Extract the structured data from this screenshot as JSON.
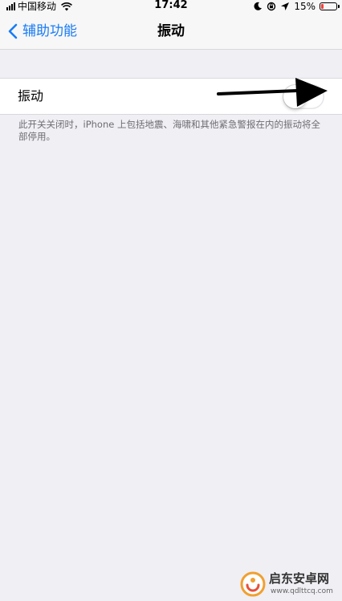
{
  "status_bar": {
    "carrier": "中国移动",
    "time": "17:42",
    "battery_percent": "15%",
    "battery_level": 0.15,
    "icons": [
      "signal-icon",
      "wifi-icon",
      "moon-icon",
      "lock-rotation-icon",
      "location-icon",
      "battery-icon"
    ]
  },
  "nav": {
    "back_label": "辅助功能",
    "title": "振动"
  },
  "settings": {
    "vibration_label": "振动",
    "vibration_enabled": false,
    "footer": "此开关关闭时，iPhone 上包括地震、海啸和其他紧急警报在内的振动将全部停用。"
  },
  "colors": {
    "accent": "#1a7cf5",
    "background": "#efeff4",
    "battery_low": "#ff3b30",
    "watermark": "#f0a030"
  },
  "watermark": {
    "title": "启东安卓网",
    "url": "www.qdlttcq.com"
  }
}
